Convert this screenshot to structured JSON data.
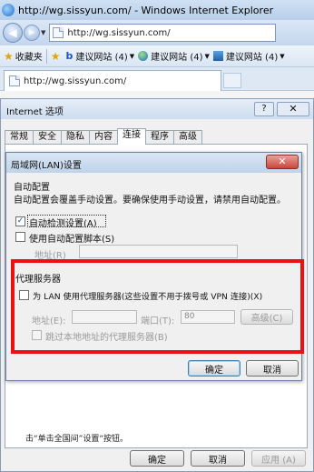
{
  "browser": {
    "title": "http://wg.sissyun.com/ - Windows Internet Explorer",
    "url": "http://wg.sissyun.com/",
    "favorites_label": "收藏夹",
    "fav_links": [
      {
        "label": "建议网站 (4)"
      },
      {
        "label": "建议网站 (4)"
      },
      {
        "label": "建议网站 (4)"
      }
    ],
    "tab_title": "http://wg.sissyun.com/"
  },
  "options_dialog": {
    "title": "Internet 选项",
    "help": "?",
    "close": "✕",
    "tabs": [
      "常规",
      "安全",
      "隐私",
      "内容",
      "连接",
      "程序",
      "高级"
    ],
    "active_tab": "连接",
    "partial_text": "击“单击全国间”设置“按钮。",
    "buttons": {
      "ok": "确定",
      "cancel": "取消",
      "apply": "应用 (A)"
    }
  },
  "lan_dialog": {
    "title": "局域网(LAN)设置",
    "close": "✕",
    "auto_config_heading": "自动配置",
    "auto_config_desc": "自动配置会覆盖手动设置。要确保使用手动设置，请禁用自动配置。",
    "auto_detect_label": "自动检测设置(A)",
    "auto_detect_checked": true,
    "use_script_label": "使用自动配置脚本(S)",
    "use_script_checked": false,
    "script_address_label": "地址(R)",
    "proxy_heading": "代理服务器",
    "use_proxy_label": "为 LAN 使用代理服务器(这些设置不用于拨号或 VPN 连接)(X)",
    "use_proxy_checked": false,
    "proxy_address_label": "地址(E):",
    "proxy_port_label": "端口(T):",
    "proxy_port_value": "80",
    "advanced_label": "高级(C)",
    "bypass_local_label": "跳过本地地址的代理服务器(B)",
    "ok": "确定",
    "cancel": "取消"
  },
  "colors": {
    "highlight_box": "#ec1111",
    "titlebar": "#cfe0f3"
  }
}
